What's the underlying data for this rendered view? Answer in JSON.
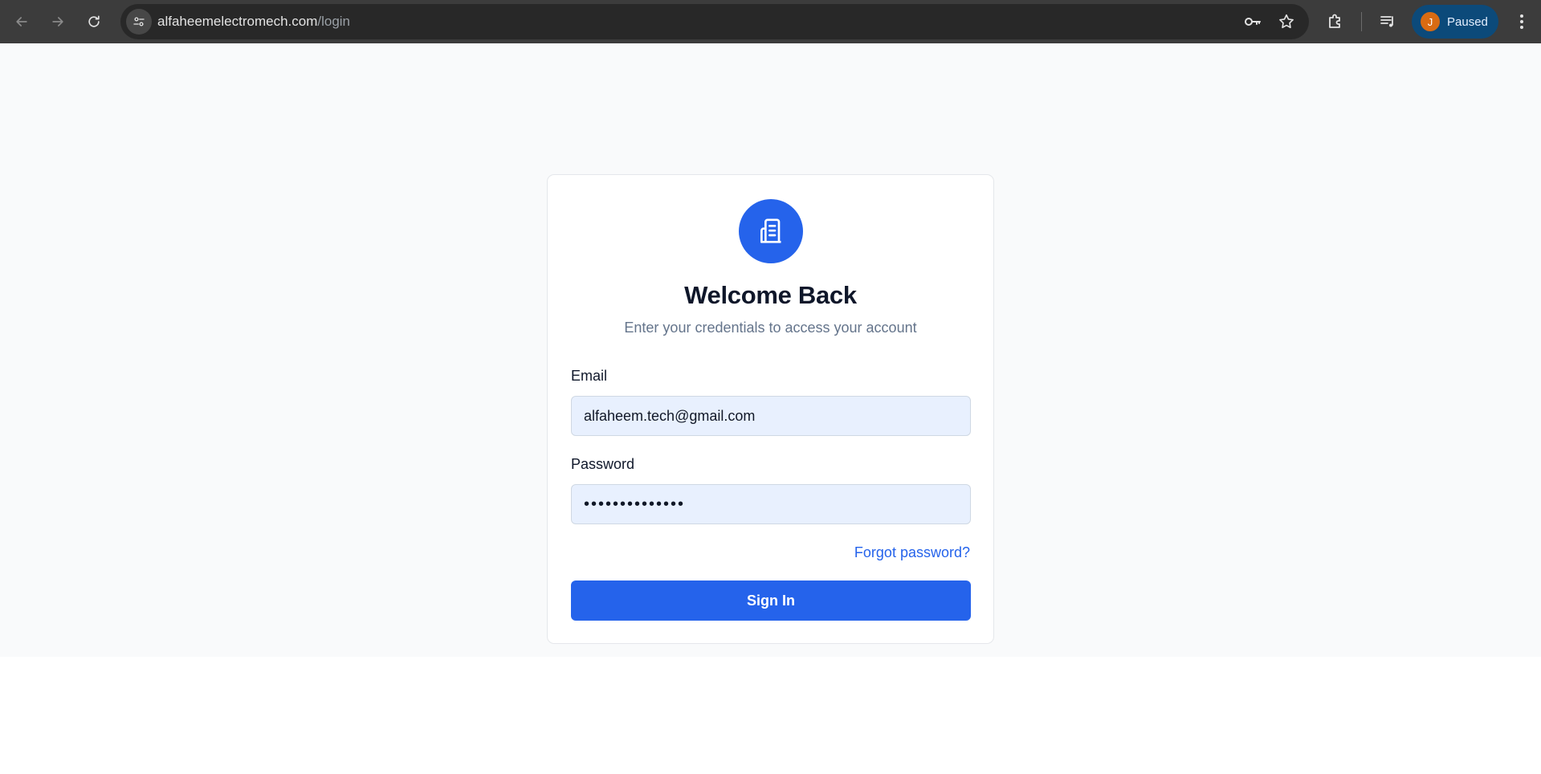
{
  "browser": {
    "url_host": "alfaheemelectromech.com",
    "url_path": "/login",
    "profile_initial": "J",
    "profile_status": "Paused"
  },
  "login": {
    "title": "Welcome Back",
    "subtitle": "Enter your credentials to access your account",
    "email_label": "Email",
    "email_value": "alfaheem.tech@gmail.com",
    "password_label": "Password",
    "password_value": "••••••••••••••",
    "forgot_label": "Forgot password?",
    "signin_label": "Sign In",
    "logo_icon": "building-icon"
  },
  "colors": {
    "accent": "#2563eb",
    "input_autofill_bg": "#e8f0fe",
    "title_text": "#0f172a",
    "muted_text": "#64748b",
    "chrome_bg": "#3c3c3c",
    "profile_bg": "#0c4a7a",
    "avatar_bg": "#d96b12"
  }
}
